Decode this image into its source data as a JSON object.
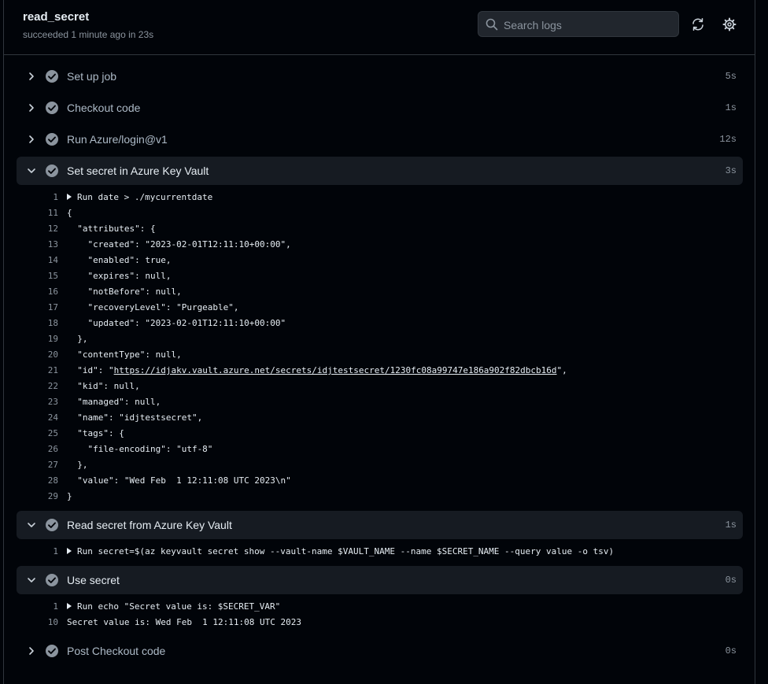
{
  "header": {
    "job_title": "read_secret",
    "job_status": "succeeded 1 minute ago in 23s",
    "search_placeholder": "Search logs"
  },
  "icons": {
    "search": "search-icon",
    "refresh": "sync-icon",
    "settings": "gear-icon",
    "chevron_collapsed": "chevron-right-icon",
    "chevron_expanded": "chevron-down-icon",
    "status": "check-circle-icon"
  },
  "colors": {
    "background": "#010409",
    "step_bar": "#161b22",
    "muted_text": "#8b949e",
    "text": "#e6edf3"
  },
  "steps": [
    {
      "name": "Set up job",
      "duration": "5s",
      "expanded": false
    },
    {
      "name": "Checkout code",
      "duration": "1s",
      "expanded": false
    },
    {
      "name": "Run Azure/login@v1",
      "duration": "12s",
      "expanded": false
    },
    {
      "name": "Set secret in Azure Key Vault",
      "duration": "3s",
      "expanded": true,
      "log": [
        {
          "num": "1",
          "text": "Run date > ./mycurrentdate",
          "group": true
        },
        {
          "num": "11",
          "text": "{"
        },
        {
          "num": "12",
          "text": "  \"attributes\": {"
        },
        {
          "num": "13",
          "text": "    \"created\": \"2023-02-01T12:11:10+00:00\","
        },
        {
          "num": "14",
          "text": "    \"enabled\": true,"
        },
        {
          "num": "15",
          "text": "    \"expires\": null,"
        },
        {
          "num": "16",
          "text": "    \"notBefore\": null,"
        },
        {
          "num": "17",
          "text": "    \"recoveryLevel\": \"Purgeable\","
        },
        {
          "num": "18",
          "text": "    \"updated\": \"2023-02-01T12:11:10+00:00\""
        },
        {
          "num": "19",
          "text": "  },"
        },
        {
          "num": "20",
          "text": "  \"contentType\": null,"
        },
        {
          "num": "21",
          "text": "  \"id\": \"",
          "link": "https://idjakv.vault.azure.net/secrets/idjtestsecret/1230fc08a99747e186a902f82dbcb16d",
          "after": "\","
        },
        {
          "num": "22",
          "text": "  \"kid\": null,"
        },
        {
          "num": "23",
          "text": "  \"managed\": null,"
        },
        {
          "num": "24",
          "text": "  \"name\": \"idjtestsecret\","
        },
        {
          "num": "25",
          "text": "  \"tags\": {"
        },
        {
          "num": "26",
          "text": "    \"file-encoding\": \"utf-8\""
        },
        {
          "num": "27",
          "text": "  },"
        },
        {
          "num": "28",
          "text": "  \"value\": \"Wed Feb  1 12:11:08 UTC 2023\\n\""
        },
        {
          "num": "29",
          "text": "}"
        }
      ]
    },
    {
      "name": "Read secret from Azure Key Vault",
      "duration": "1s",
      "expanded": true,
      "log": [
        {
          "num": "1",
          "text": "Run secret=$(az keyvault secret show --vault-name $VAULT_NAME --name $SECRET_NAME --query value -o tsv)",
          "group": true
        }
      ]
    },
    {
      "name": "Use secret",
      "duration": "0s",
      "expanded": true,
      "log": [
        {
          "num": "1",
          "text": "Run echo \"Secret value is: $SECRET_VAR\"",
          "group": true
        },
        {
          "num": "10",
          "text": "Secret value is: Wed Feb  1 12:11:08 UTC 2023"
        }
      ]
    },
    {
      "name": "Post Checkout code",
      "duration": "0s",
      "expanded": false
    }
  ]
}
